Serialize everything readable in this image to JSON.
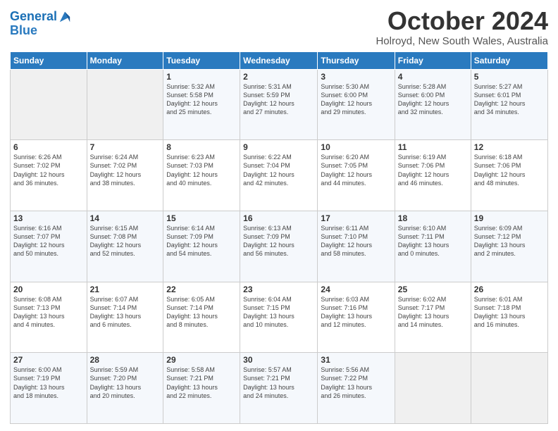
{
  "logo": {
    "line1": "General",
    "line2": "Blue"
  },
  "title": "October 2024",
  "subtitle": "Holroyd, New South Wales, Australia",
  "days_header": [
    "Sunday",
    "Monday",
    "Tuesday",
    "Wednesday",
    "Thursday",
    "Friday",
    "Saturday"
  ],
  "weeks": [
    [
      {
        "day": "",
        "info": ""
      },
      {
        "day": "",
        "info": ""
      },
      {
        "day": "1",
        "info": "Sunrise: 5:32 AM\nSunset: 5:58 PM\nDaylight: 12 hours\nand 25 minutes."
      },
      {
        "day": "2",
        "info": "Sunrise: 5:31 AM\nSunset: 5:59 PM\nDaylight: 12 hours\nand 27 minutes."
      },
      {
        "day": "3",
        "info": "Sunrise: 5:30 AM\nSunset: 6:00 PM\nDaylight: 12 hours\nand 29 minutes."
      },
      {
        "day": "4",
        "info": "Sunrise: 5:28 AM\nSunset: 6:00 PM\nDaylight: 12 hours\nand 32 minutes."
      },
      {
        "day": "5",
        "info": "Sunrise: 5:27 AM\nSunset: 6:01 PM\nDaylight: 12 hours\nand 34 minutes."
      }
    ],
    [
      {
        "day": "6",
        "info": "Sunrise: 6:26 AM\nSunset: 7:02 PM\nDaylight: 12 hours\nand 36 minutes."
      },
      {
        "day": "7",
        "info": "Sunrise: 6:24 AM\nSunset: 7:02 PM\nDaylight: 12 hours\nand 38 minutes."
      },
      {
        "day": "8",
        "info": "Sunrise: 6:23 AM\nSunset: 7:03 PM\nDaylight: 12 hours\nand 40 minutes."
      },
      {
        "day": "9",
        "info": "Sunrise: 6:22 AM\nSunset: 7:04 PM\nDaylight: 12 hours\nand 42 minutes."
      },
      {
        "day": "10",
        "info": "Sunrise: 6:20 AM\nSunset: 7:05 PM\nDaylight: 12 hours\nand 44 minutes."
      },
      {
        "day": "11",
        "info": "Sunrise: 6:19 AM\nSunset: 7:06 PM\nDaylight: 12 hours\nand 46 minutes."
      },
      {
        "day": "12",
        "info": "Sunrise: 6:18 AM\nSunset: 7:06 PM\nDaylight: 12 hours\nand 48 minutes."
      }
    ],
    [
      {
        "day": "13",
        "info": "Sunrise: 6:16 AM\nSunset: 7:07 PM\nDaylight: 12 hours\nand 50 minutes."
      },
      {
        "day": "14",
        "info": "Sunrise: 6:15 AM\nSunset: 7:08 PM\nDaylight: 12 hours\nand 52 minutes."
      },
      {
        "day": "15",
        "info": "Sunrise: 6:14 AM\nSunset: 7:09 PM\nDaylight: 12 hours\nand 54 minutes."
      },
      {
        "day": "16",
        "info": "Sunrise: 6:13 AM\nSunset: 7:09 PM\nDaylight: 12 hours\nand 56 minutes."
      },
      {
        "day": "17",
        "info": "Sunrise: 6:11 AM\nSunset: 7:10 PM\nDaylight: 12 hours\nand 58 minutes."
      },
      {
        "day": "18",
        "info": "Sunrise: 6:10 AM\nSunset: 7:11 PM\nDaylight: 13 hours\nand 0 minutes."
      },
      {
        "day": "19",
        "info": "Sunrise: 6:09 AM\nSunset: 7:12 PM\nDaylight: 13 hours\nand 2 minutes."
      }
    ],
    [
      {
        "day": "20",
        "info": "Sunrise: 6:08 AM\nSunset: 7:13 PM\nDaylight: 13 hours\nand 4 minutes."
      },
      {
        "day": "21",
        "info": "Sunrise: 6:07 AM\nSunset: 7:14 PM\nDaylight: 13 hours\nand 6 minutes."
      },
      {
        "day": "22",
        "info": "Sunrise: 6:05 AM\nSunset: 7:14 PM\nDaylight: 13 hours\nand 8 minutes."
      },
      {
        "day": "23",
        "info": "Sunrise: 6:04 AM\nSunset: 7:15 PM\nDaylight: 13 hours\nand 10 minutes."
      },
      {
        "day": "24",
        "info": "Sunrise: 6:03 AM\nSunset: 7:16 PM\nDaylight: 13 hours\nand 12 minutes."
      },
      {
        "day": "25",
        "info": "Sunrise: 6:02 AM\nSunset: 7:17 PM\nDaylight: 13 hours\nand 14 minutes."
      },
      {
        "day": "26",
        "info": "Sunrise: 6:01 AM\nSunset: 7:18 PM\nDaylight: 13 hours\nand 16 minutes."
      }
    ],
    [
      {
        "day": "27",
        "info": "Sunrise: 6:00 AM\nSunset: 7:19 PM\nDaylight: 13 hours\nand 18 minutes."
      },
      {
        "day": "28",
        "info": "Sunrise: 5:59 AM\nSunset: 7:20 PM\nDaylight: 13 hours\nand 20 minutes."
      },
      {
        "day": "29",
        "info": "Sunrise: 5:58 AM\nSunset: 7:21 PM\nDaylight: 13 hours\nand 22 minutes."
      },
      {
        "day": "30",
        "info": "Sunrise: 5:57 AM\nSunset: 7:21 PM\nDaylight: 13 hours\nand 24 minutes."
      },
      {
        "day": "31",
        "info": "Sunrise: 5:56 AM\nSunset: 7:22 PM\nDaylight: 13 hours\nand 26 minutes."
      },
      {
        "day": "",
        "info": ""
      },
      {
        "day": "",
        "info": ""
      }
    ]
  ]
}
